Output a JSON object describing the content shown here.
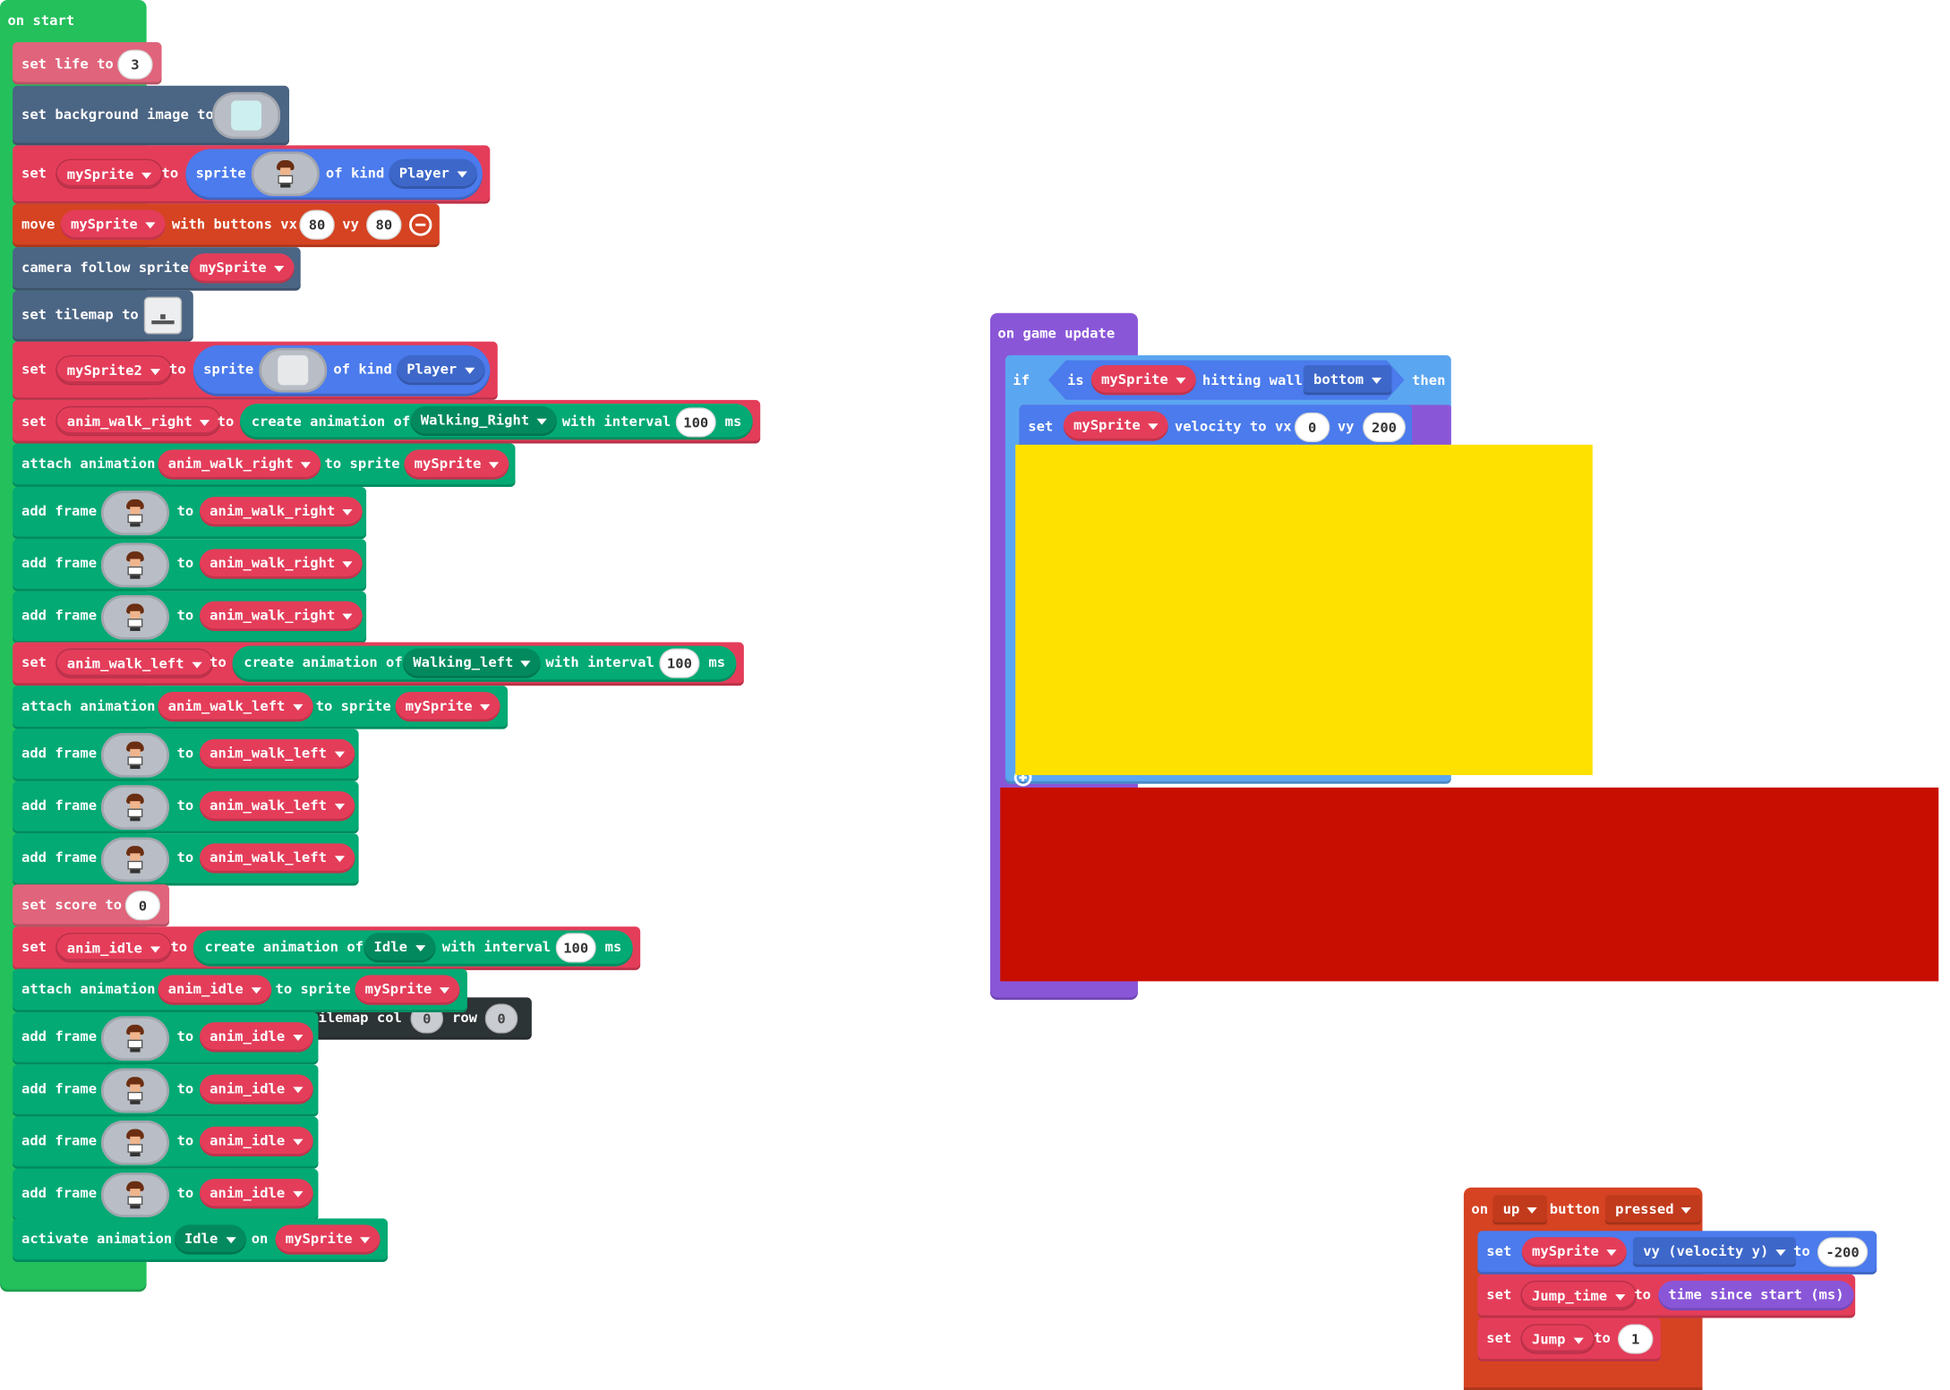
{
  "on_start": {
    "header": "on start",
    "set_life": {
      "set": "set",
      "var": "life",
      "to": "to",
      "value": "3"
    },
    "set_background": {
      "label": "set background image to"
    },
    "set_mysprite": {
      "set": "set",
      "var": "mySprite",
      "to": "to",
      "sprite": "sprite",
      "of_kind": "of kind",
      "kind": "Player"
    },
    "move": {
      "move": "move",
      "var": "mySprite",
      "with_buttons": "with buttons vx",
      "vx": "80",
      "vy_label": "vy",
      "vy": "80"
    },
    "camera": {
      "label": "camera follow sprite",
      "var": "mySprite"
    },
    "set_tilemap": {
      "label": "set tilemap to"
    },
    "set_mysprite2": {
      "set": "set",
      "var": "mySprite2",
      "to": "to",
      "sprite": "sprite",
      "of_kind": "of kind",
      "kind": "Player"
    },
    "anim_right": {
      "set": "set",
      "var": "anim_walk_right",
      "to": "to",
      "create": "create animation of",
      "anim": "Walking_Right",
      "with_interval": "with interval",
      "interval": "100",
      "ms": "ms"
    },
    "attach_right": {
      "label": "attach animation",
      "anim": "anim_walk_right",
      "to_sprite": "to sprite",
      "sprite": "mySprite"
    },
    "frames_right": [
      {
        "add": "add frame",
        "to": "to",
        "anim": "anim_walk_right"
      },
      {
        "add": "add frame",
        "to": "to",
        "anim": "anim_walk_right"
      },
      {
        "add": "add frame",
        "to": "to",
        "anim": "anim_walk_right"
      }
    ],
    "anim_left": {
      "set": "set",
      "var": "anim_walk_left",
      "to": "to",
      "create": "create animation of",
      "anim": "Walking_left",
      "with_interval": "with interval",
      "interval": "100",
      "ms": "ms"
    },
    "attach_left": {
      "label": "attach animation",
      "anim": "anim_walk_left",
      "to_sprite": "to sprite",
      "sprite": "mySprite"
    },
    "frames_left": [
      {
        "add": "add frame",
        "to": "to",
        "anim": "anim_walk_left"
      },
      {
        "add": "add frame",
        "to": "to",
        "anim": "anim_walk_left"
      },
      {
        "add": "add frame",
        "to": "to",
        "anim": "anim_walk_left"
      }
    ],
    "set_score": {
      "set": "set",
      "var": "score",
      "to": "to",
      "value": "0"
    },
    "anim_idle": {
      "set": "set",
      "var": "anim_idle",
      "to": "to",
      "create": "create animation of",
      "anim": "Idle",
      "with_interval": "with interval",
      "interval": "100",
      "ms": "ms"
    },
    "attach_idle": {
      "label": "attach animation",
      "anim": "anim_idle",
      "to_sprite": "to sprite",
      "sprite": "mySprite"
    },
    "tilemap_fragment": {
      "label": "ilemap col",
      "col": "0",
      "row_label": "row",
      "row": "0"
    },
    "frames_idle": [
      {
        "add": "add frame",
        "to": "to",
        "anim": "anim_idle"
      },
      {
        "add": "add frame",
        "to": "to",
        "anim": "anim_idle"
      },
      {
        "add": "add frame",
        "to": "to",
        "anim": "anim_idle"
      },
      {
        "add": "add frame",
        "to": "to",
        "anim": "anim_idle"
      }
    ],
    "activate": {
      "label": "activate animation",
      "anim": "Idle",
      "on": "on",
      "sprite": "mySprite"
    }
  },
  "game_update": {
    "header": "on game update",
    "if": "if",
    "is": "is",
    "sprite": "mySprite",
    "hitting_wall": "hitting wall",
    "side": "bottom",
    "then": "then",
    "set_velocity": {
      "set": "set",
      "sprite": "mySprite",
      "label": "velocity to vx",
      "vx": "0",
      "vy_label": "vy",
      "vy": "200"
    }
  },
  "on_up": {
    "on": "on",
    "button": "up",
    "button_label": "button",
    "event": "pressed",
    "set_vy": {
      "set": "set",
      "sprite": "mySprite",
      "prop": "vy (velocity y)",
      "to": "to",
      "value": "-200"
    },
    "set_jump_time": {
      "set": "set",
      "var": "Jump_time",
      "to": "to",
      "value": "time since start (ms)"
    },
    "set_jump": {
      "set": "set",
      "var": "Jump",
      "to": "to",
      "value": "1"
    }
  },
  "colors": {
    "event_green": "#23c05c",
    "variables_red": "#e43d5a",
    "scene_slate": "#4b6584",
    "sprites_blue": "#4b7bec",
    "animation_teal": "#03aa74",
    "controller_orange": "#d54322",
    "logic_blue": "#5ba6f0",
    "game_purple": "#8a56d8",
    "overlay_yellow": "#ffe100",
    "overlay_red": "#c80e00"
  }
}
